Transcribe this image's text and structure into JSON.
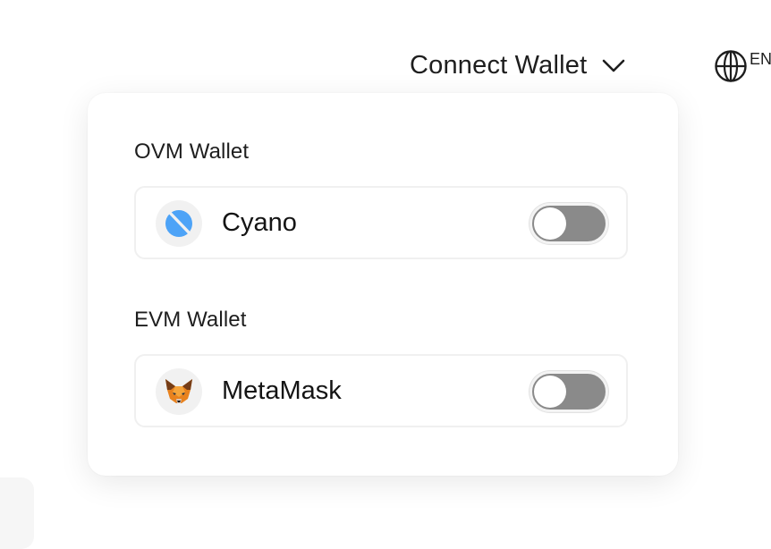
{
  "header": {
    "connect_wallet_label": "Connect Wallet",
    "chevron_icon": "chevron-down-icon",
    "language_icon": "globe-icon",
    "language_label": "EN"
  },
  "dropdown": {
    "sections": [
      {
        "title": "OVM Wallet",
        "wallet": {
          "name": "Cyano",
          "icon": "cyano-logo-icon",
          "icon_color": "#4da3f7",
          "enabled": false
        }
      },
      {
        "title": "EVM Wallet",
        "wallet": {
          "name": "MetaMask",
          "icon": "metamask-fox-icon",
          "icon_color": "#e8821e",
          "enabled": false
        }
      }
    ]
  },
  "colors": {
    "toggle_off": "#8a8a8a",
    "row_border": "#f0f0f0",
    "text": "#1e1e1e"
  }
}
